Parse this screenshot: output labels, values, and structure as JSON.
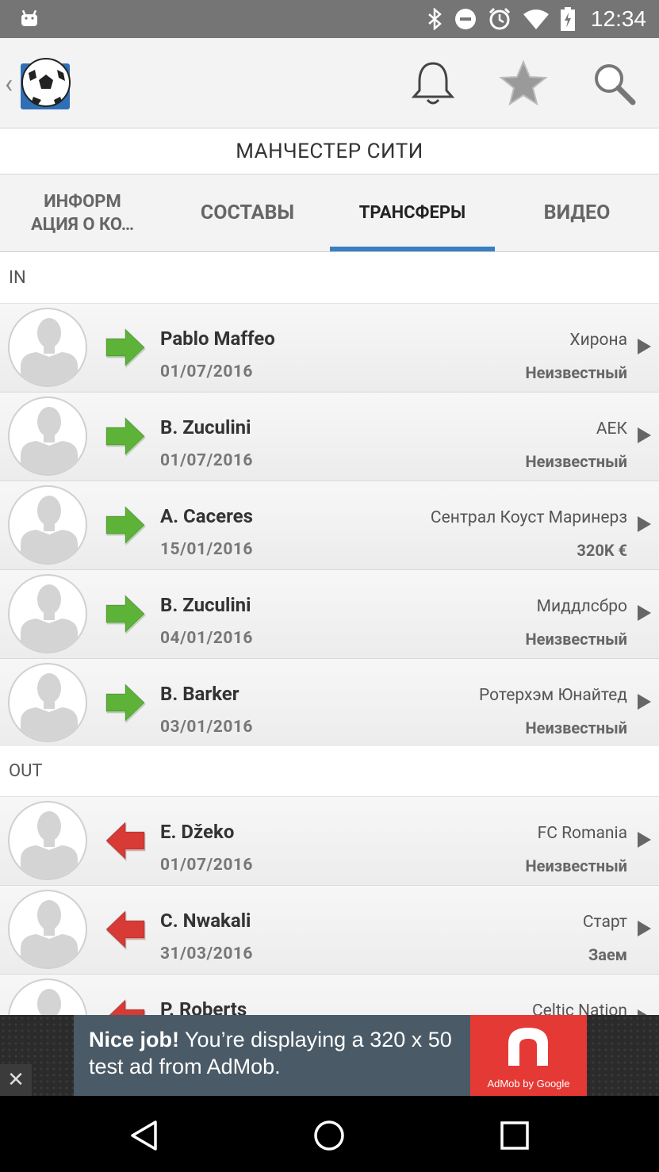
{
  "status_bar": {
    "time": "12:34"
  },
  "header": {
    "team_title": "МАНЧЕСТЕР СИТИ"
  },
  "tabs": [
    {
      "label_line1": "ИНФОРМ",
      "label_line2": "АЦИЯ О КО…",
      "active": false
    },
    {
      "label": "СОСТАВЫ",
      "active": false
    },
    {
      "label": "ТРАНСФЕРЫ",
      "active": true
    },
    {
      "label": "ВИДЕО",
      "active": false
    }
  ],
  "sections": {
    "in": {
      "title": "IN",
      "transfers": [
        {
          "name": "Pablo Maffeo",
          "date": "01/07/2016",
          "club": "Хирона",
          "fee": "Неизвестный"
        },
        {
          "name": "B. Zuculini",
          "date": "01/07/2016",
          "club": "АЕК",
          "fee": "Неизвестный"
        },
        {
          "name": "A. Caceres",
          "date": "15/01/2016",
          "club": "Сентрал Коуст Маринерз",
          "fee": "320K €"
        },
        {
          "name": "B. Zuculini",
          "date": "04/01/2016",
          "club": "Миддлсбро",
          "fee": "Неизвестный"
        },
        {
          "name": "B. Barker",
          "date": "03/01/2016",
          "club": "Ротерхэм Юнайтед",
          "fee": "Неизвестный"
        }
      ]
    },
    "out": {
      "title": "OUT",
      "transfers": [
        {
          "name": "E. Džeko",
          "date": "01/07/2016",
          "club": "FC Romania",
          "fee": "Неизвестный"
        },
        {
          "name": "C. Nwakali",
          "date": "31/03/2016",
          "club": "Старт",
          "fee": "Заем"
        },
        {
          "name": "P. Roberts",
          "date": "",
          "club": "Celtic Nation",
          "fee": ""
        }
      ]
    }
  },
  "ad": {
    "headline": "Nice job!",
    "text": "You’re displaying a 320 x 50 test ad from AdMob.",
    "logo_caption": "AdMob by Google",
    "close": "✕"
  },
  "colors": {
    "tab_indicator": "#3a7fc1",
    "in_arrow": "#5cb338",
    "out_arrow": "#d83a36",
    "status_bar": "#757575"
  },
  "icons": {
    "notifications": "bell-icon",
    "favorite": "star-icon",
    "search": "search-icon"
  }
}
